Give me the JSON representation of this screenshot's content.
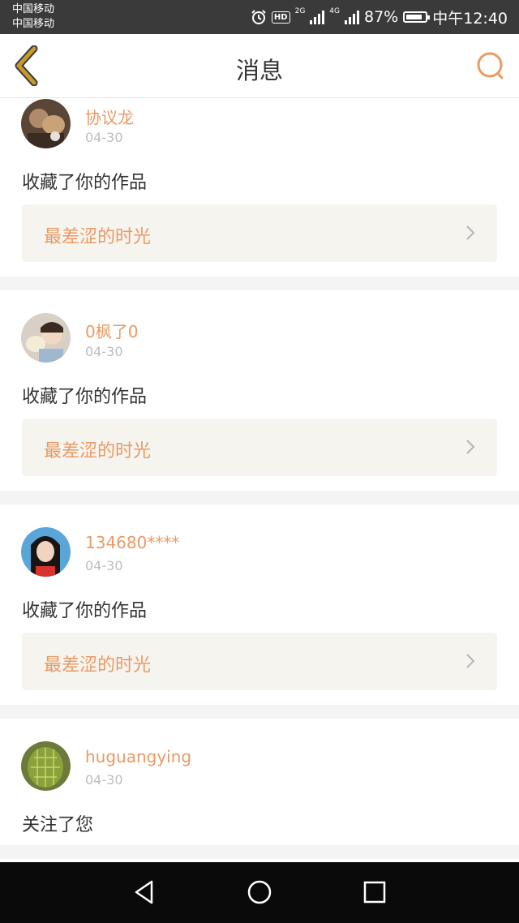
{
  "status_bar": {
    "carrier_1": "中国移动",
    "carrier_2": "中国移动",
    "network_1": "2G",
    "network_2": "4G",
    "battery": "87%",
    "battery_level": 0.87,
    "time": "中午12:40",
    "hd_label": "HD",
    "icons": [
      "alarm-icon",
      "hd-icon",
      "signal-icon",
      "battery-icon"
    ]
  },
  "header": {
    "title": "消息",
    "back_icon": "chevron-left-icon",
    "search_icon": "search-icon",
    "accent": "#ea9a64",
    "back_color": "#c89a2c"
  },
  "messages": [
    {
      "user": "协议龙",
      "date": "04-30",
      "action": "收藏了你的作品",
      "work_title": "最差涩的时光"
    },
    {
      "user": "0枫了0",
      "date": "04-30",
      "action": "收藏了你的作品",
      "work_title": "最差涩的时光"
    },
    {
      "user": "134680****",
      "date": "04-30",
      "action": "收藏了你的作品",
      "work_title": "最差涩的时光"
    },
    {
      "user": "huguangying",
      "date": "04-30",
      "action": "关注了您"
    }
  ],
  "nav_bar": {
    "icons": [
      "back-triangle-icon",
      "home-circle-icon",
      "recents-square-icon"
    ]
  }
}
